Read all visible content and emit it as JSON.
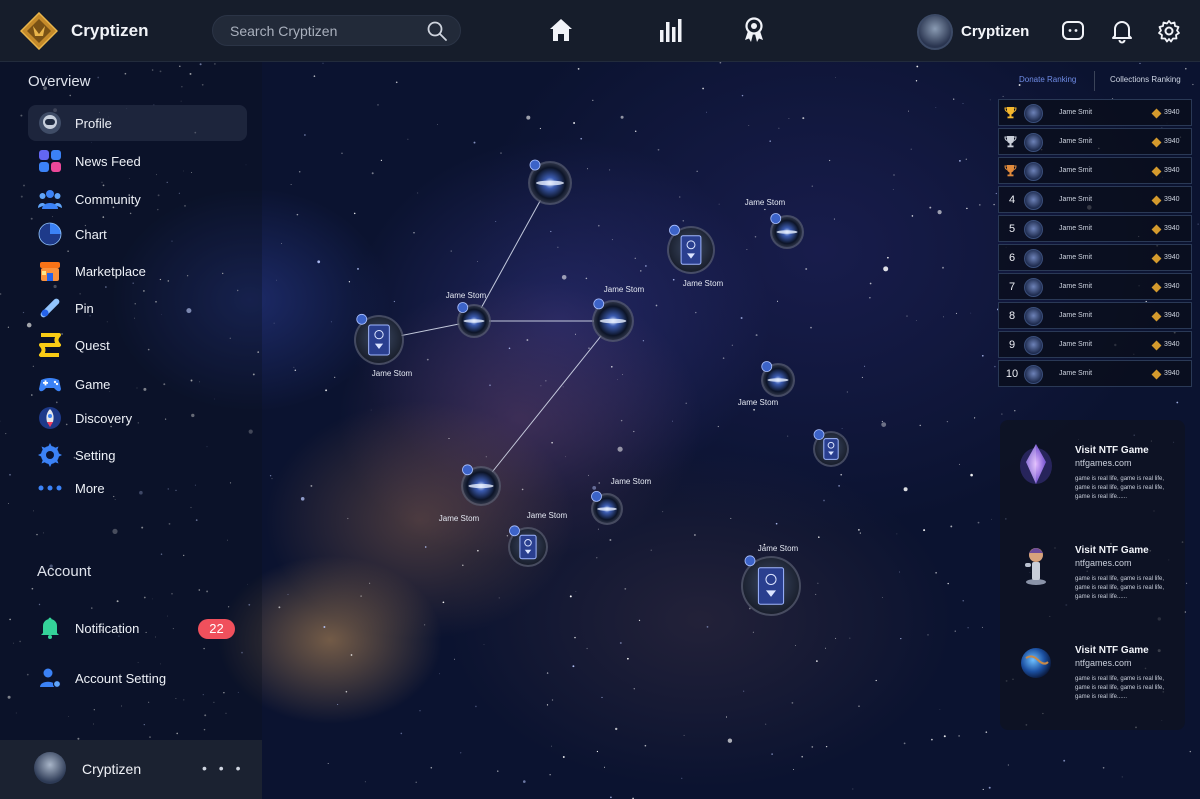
{
  "header": {
    "brand": "Cryptizen",
    "search_placeholder": "Search Cryptizen",
    "user_name": "Cryptizen"
  },
  "sidebar": {
    "overview_title": "Overview",
    "items": [
      {
        "label": "Profile",
        "icon": "astronaut-avatar-icon",
        "active": true
      },
      {
        "label": "News Feed",
        "icon": "news-feed-icon"
      },
      {
        "label": "Community",
        "icon": "community-icon"
      },
      {
        "label": "Chart",
        "icon": "chart-icon"
      },
      {
        "label": "Marketplace",
        "icon": "marketplace-icon"
      },
      {
        "label": "Pin",
        "icon": "pin-icon"
      },
      {
        "label": "Quest",
        "icon": "quest-icon"
      },
      {
        "label": "Game",
        "icon": "gamepad-icon"
      },
      {
        "label": "Discovery",
        "icon": "rocket-icon"
      },
      {
        "label": "Setting",
        "icon": "gear-icon"
      },
      {
        "label": "More",
        "icon": "more-dots-icon"
      }
    ],
    "account_title": "Account",
    "account_items": [
      {
        "label": "Notification",
        "icon": "bell-icon",
        "badge": "22"
      },
      {
        "label": "Account Setting",
        "icon": "user-settings-icon"
      }
    ],
    "bottom_user": {
      "name": "Cryptizen",
      "menu": "• • •"
    }
  },
  "network": {
    "labels": [
      "Jame Stom",
      "Jame Stom",
      "Jame Stom",
      "Jame Stom",
      "Jame Stom",
      "Jame Stom",
      "Jame Stom",
      "Jame Stom",
      "Jame Stom",
      "Jame Stom"
    ]
  },
  "ranking": {
    "tabs": [
      "Donate Ranking",
      "Collections Ranking"
    ],
    "active_tab": "Donate Ranking",
    "rows": [
      {
        "rank": "1",
        "trophy": "gold",
        "name": "Jame Smit",
        "score": "3940"
      },
      {
        "rank": "2",
        "trophy": "silver",
        "name": "Jame Smit",
        "score": "3940"
      },
      {
        "rank": "3",
        "trophy": "bronze",
        "name": "Jame Smit",
        "score": "3940"
      },
      {
        "rank": "4",
        "name": "Jame Smit",
        "score": "3940"
      },
      {
        "rank": "5",
        "name": "Jame Smit",
        "score": "3940"
      },
      {
        "rank": "6",
        "name": "Jame Smit",
        "score": "3940"
      },
      {
        "rank": "7",
        "name": "Jame Smit",
        "score": "3940"
      },
      {
        "rank": "8",
        "name": "Jame Smit",
        "score": "3940"
      },
      {
        "rank": "9",
        "name": "Jame Smit",
        "score": "3940"
      },
      {
        "rank": "10",
        "name": "Jame Smit",
        "score": "3940"
      }
    ]
  },
  "games": [
    {
      "title": "Visit NTF Game",
      "url": "ntfgames.com",
      "desc": "game is real life, game is real life, game is real life, game is real life, game is real life......",
      "thumb": "crystal-icon"
    },
    {
      "title": "Visit NTF Game",
      "url": "ntfgames.com",
      "desc": "game is real life, game is real life, game is real life, game is real life, game is real life......",
      "thumb": "character-figure-icon"
    },
    {
      "title": "Visit NTF Game",
      "url": "ntfgames.com",
      "desc": "game is real life, game is real life, game is real life, game is real life, game is real life......",
      "thumb": "planet-icon"
    }
  ],
  "colors": {
    "accent": "#6f8ce6",
    "badge": "#f0505c",
    "panel": "#161d2b",
    "gold": "#d49a2d"
  }
}
